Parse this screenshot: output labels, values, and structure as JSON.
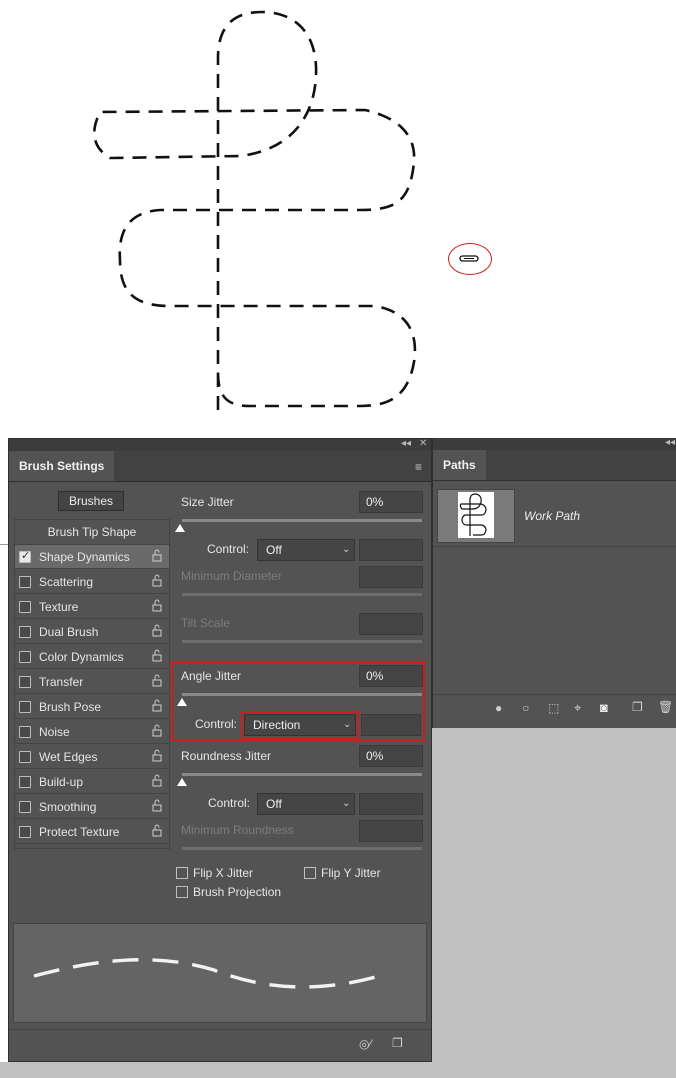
{
  "brush_settings": {
    "tab_title": "Brush Settings",
    "brushes_button": "Brushes",
    "brush_tip_shape": "Brush Tip Shape",
    "options": [
      {
        "label": "Shape Dynamics",
        "checked": true
      },
      {
        "label": "Scattering",
        "checked": false
      },
      {
        "label": "Texture",
        "checked": false
      },
      {
        "label": "Dual Brush",
        "checked": false
      },
      {
        "label": "Color Dynamics",
        "checked": false
      },
      {
        "label": "Transfer",
        "checked": false
      },
      {
        "label": "Brush Pose",
        "checked": false
      },
      {
        "label": "Noise",
        "checked": false
      },
      {
        "label": "Wet Edges",
        "checked": false
      },
      {
        "label": "Build-up",
        "checked": false
      },
      {
        "label": "Smoothing",
        "checked": false
      },
      {
        "label": "Protect Texture",
        "checked": false
      }
    ],
    "size_jitter": {
      "label": "Size Jitter",
      "value": "0%"
    },
    "size_control": {
      "label": "Control:",
      "value": "Off"
    },
    "minimum_diameter": {
      "label": "Minimum Diameter"
    },
    "tilt_scale": {
      "label": "Tilt Scale"
    },
    "angle_jitter": {
      "label": "Angle Jitter",
      "value": "0%"
    },
    "angle_control": {
      "label": "Control:",
      "value": "Direction"
    },
    "roundness_jitter": {
      "label": "Roundness Jitter",
      "value": "0%"
    },
    "roundness_control": {
      "label": "Control:",
      "value": "Off"
    },
    "minimum_roundness": {
      "label": "Minimum Roundness"
    },
    "flip_x": "Flip X Jitter",
    "flip_y": "Flip Y Jitter",
    "brush_projection": "Brush Projection"
  },
  "paths_panel": {
    "tab_title": "Paths",
    "work_path": "Work Path"
  },
  "colors": {
    "panel_bg": "#535353",
    "highlight_red": "#d01b1b"
  }
}
